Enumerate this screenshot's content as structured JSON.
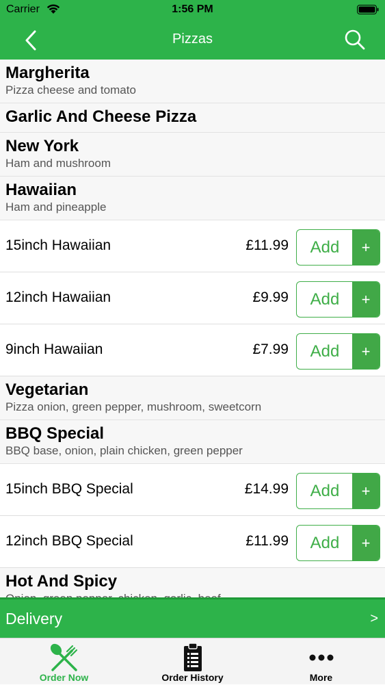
{
  "status_bar": {
    "carrier": "Carrier",
    "time": "1:56 PM"
  },
  "nav": {
    "title": "Pizzas",
    "back_icon": "chevron-left-icon",
    "search_icon": "search-icon"
  },
  "menu": [
    {
      "type": "category",
      "name": "Margherita",
      "description": "Pizza cheese and tomato"
    },
    {
      "type": "category",
      "name": "Garlic And Cheese Pizza",
      "description": ""
    },
    {
      "type": "category",
      "name": "New York",
      "description": "Ham and mushroom"
    },
    {
      "type": "category",
      "name": "Hawaiian",
      "description": "Ham and pineapple"
    },
    {
      "type": "item",
      "name": "15inch Hawaiian",
      "price": "£11.99",
      "add_label": "Add",
      "plus": "+"
    },
    {
      "type": "item",
      "name": "12inch Hawaiian",
      "price": "£9.99",
      "add_label": "Add",
      "plus": "+"
    },
    {
      "type": "item",
      "name": "9inch Hawaiian",
      "price": "£7.99",
      "add_label": "Add",
      "plus": "+"
    },
    {
      "type": "category",
      "name": "Vegetarian",
      "description": "Pizza onion, green pepper, mushroom, sweetcorn"
    },
    {
      "type": "category",
      "name": "BBQ Special",
      "description": "BBQ base, onion, plain chicken, green pepper"
    },
    {
      "type": "item",
      "name": "15inch BBQ Special",
      "price": "£14.99",
      "add_label": "Add",
      "plus": "+"
    },
    {
      "type": "item",
      "name": "12inch BBQ Special",
      "price": "£11.99",
      "add_label": "Add",
      "plus": "+"
    },
    {
      "type": "category",
      "name": "Hot And Spicy",
      "description": "Onion, green pepper, chicken, garlic, beef"
    }
  ],
  "delivery": {
    "label": "Delivery",
    "arrow": ">"
  },
  "tabs": [
    {
      "label": "Order Now",
      "icon": "fork-knife-icon",
      "active": true
    },
    {
      "label": "Order History",
      "icon": "clipboard-list-icon",
      "active": false
    },
    {
      "label": "More",
      "icon": "more-dots-icon",
      "active": false
    }
  ],
  "colors": {
    "brand_green": "#2db34a",
    "button_green": "#41a847",
    "tab_active": "#2db34a"
  }
}
